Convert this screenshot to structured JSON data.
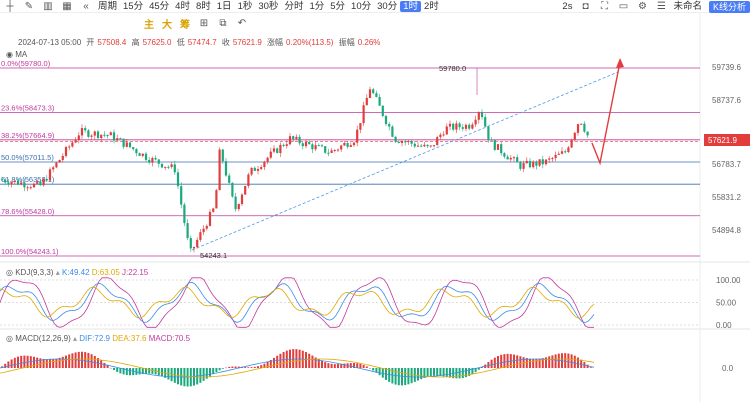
{
  "toolbar": {
    "period_label": "周期",
    "intervals": [
      "15分",
      "45分",
      "4时",
      "8时",
      "1日",
      "1秒",
      "30秒",
      "分时",
      "1分",
      "5分",
      "10分",
      "30分",
      "1时",
      "2时"
    ],
    "active_interval": "1时",
    "indicators": [
      "主",
      "大",
      "筹"
    ],
    "right_label": "2s",
    "unnamed_label": "未命名",
    "kline_label": "K线分析"
  },
  "ohlc": {
    "date": "2024-07-13 05:00",
    "open_label": "开",
    "open": "57508.4",
    "high_label": "高",
    "high": "57625.0",
    "low_label": "低",
    "low": "57474.7",
    "close_label": "收",
    "close": "57621.9",
    "change_label": "涨幅",
    "change": "0.20%(113.5)",
    "amp_label": "振幅",
    "amp": "0.26%"
  },
  "ma_label": "MA",
  "fib_levels": [
    {
      "label": "0.0%(59780.0)",
      "price": 59780.0
    },
    {
      "label": "23.6%(58473.3)",
      "price": 58473.3
    },
    {
      "label": "38.2%(57664.9)",
      "price": 57664.9
    },
    {
      "label": "50.0%(57011.5)",
      "price": 57011.5
    },
    {
      "label": "61.8%(56358.1)",
      "price": 56358.1
    },
    {
      "label": "78.6%(55428.0)",
      "price": 55428.0
    },
    {
      "label": "100.0%(54243.1)",
      "price": 54243.1
    }
  ],
  "price_axis": [
    "59739.6",
    "58737.6",
    "57621.9",
    "56783.7",
    "55831.2",
    "54894.8"
  ],
  "current_price": "57621.9",
  "annotations": {
    "high": "59780.0",
    "low": "54243.1"
  },
  "kdj": {
    "label": "KDJ(9,3,3)",
    "k": "K:49.42",
    "d": "D:63.05",
    "j": "J:22.15",
    "axis": [
      "100.00",
      "50.00",
      "0.00"
    ]
  },
  "macd": {
    "label": "MACD(12,26,9)",
    "dif": "DIF:72.9",
    "dea": "DEA:37.6",
    "macd": "MACD:70.5",
    "axis": [
      "0.0"
    ]
  },
  "colors": {
    "up": "#e23c3c",
    "down": "#1aa97b",
    "fib": "#c0399f",
    "accent": "#4a7cf6"
  }
}
